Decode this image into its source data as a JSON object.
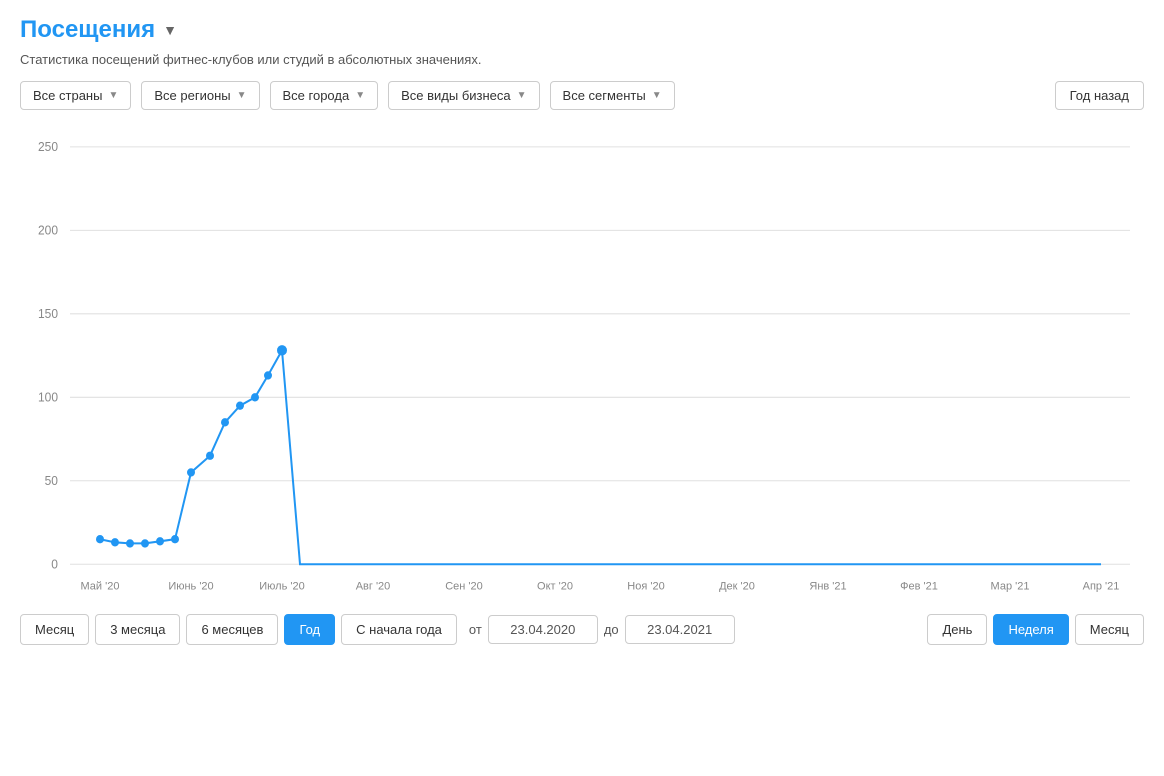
{
  "header": {
    "title": "Посещения",
    "dropdown_icon": "▼"
  },
  "subtitle": "Статистика посещений фитнес-клубов или студий в абсолютных значениях.",
  "filters": [
    {
      "id": "countries",
      "label": "Все страны"
    },
    {
      "id": "regions",
      "label": "Все регионы"
    },
    {
      "id": "cities",
      "label": "Все города"
    },
    {
      "id": "business",
      "label": "Все виды бизнеса"
    },
    {
      "id": "segments",
      "label": "Все сегменты"
    }
  ],
  "year_back_btn": "Год назад",
  "chart": {
    "y_labels": [
      "0",
      "50",
      "100",
      "150",
      "200",
      "250"
    ],
    "x_labels": [
      "Май '20",
      "Июнь '20",
      "Июль '20",
      "Авг '20",
      "Сен '20",
      "Окт '20",
      "Ноя '20",
      "Дек '20",
      "Янв '21",
      "Фев '21",
      "Мар '21",
      "Апр '21"
    ],
    "line_color": "#2196f3",
    "grid_color": "#e0e0e0"
  },
  "period_buttons": [
    {
      "id": "month",
      "label": "Месяц",
      "active": false
    },
    {
      "id": "3months",
      "label": "3 месяца",
      "active": false
    },
    {
      "id": "6months",
      "label": "6 месяцев",
      "active": false
    },
    {
      "id": "year",
      "label": "Год",
      "active": true
    },
    {
      "id": "ytd",
      "label": "С начала года",
      "active": false
    }
  ],
  "date_range": {
    "from_label": "от",
    "to_label": "до",
    "from_value": "23.04.2020",
    "to_value": "23.04.2021"
  },
  "granularity_buttons": [
    {
      "id": "day",
      "label": "День",
      "active": false
    },
    {
      "id": "week",
      "label": "Неделя",
      "active": true
    },
    {
      "id": "month_gran",
      "label": "Месяц",
      "active": false
    }
  ]
}
